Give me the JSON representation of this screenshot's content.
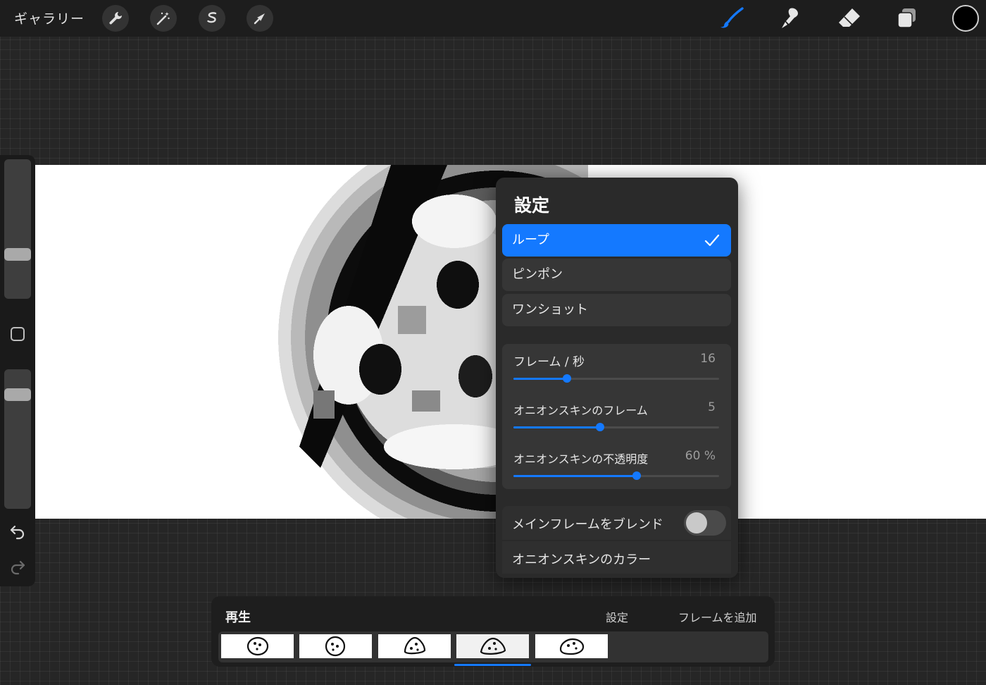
{
  "topbar": {
    "gallery_label": "ギャラリー",
    "left_tools": [
      "wrench-icon",
      "magic-wand-icon",
      "selection-icon",
      "transform-arrow-icon"
    ],
    "right_tools": [
      "brush-icon",
      "smudge-icon",
      "eraser-icon",
      "layers-icon"
    ],
    "active_tool": "brush-icon",
    "current_color": "#000000"
  },
  "sidebar": {
    "brush_size_level": 0.3,
    "opacity_level": 0.85,
    "icons": [
      "modify-square-icon",
      "undo-icon",
      "redo-icon"
    ]
  },
  "popover": {
    "title": "設定",
    "modes": [
      {
        "label": "ループ",
        "selected": true
      },
      {
        "label": "ピンポン",
        "selected": false
      },
      {
        "label": "ワンショット",
        "selected": false
      }
    ],
    "sliders": [
      {
        "label": "フレーム / 秒",
        "value": "16",
        "level": 0.26
      },
      {
        "label": "オニオンスキンのフレーム",
        "value": "5",
        "level": 0.42
      },
      {
        "label": "オニオンスキンの不透明度",
        "value": "60 %",
        "level": 0.6
      }
    ],
    "blend_label": "メインフレームをブレンド",
    "blend_on": false,
    "onion_color_label": "オニオンスキンのカラー"
  },
  "timeline": {
    "play_label": "再生",
    "settings_label": "設定",
    "add_frame_label": "フレームを追加",
    "frame_count": 5,
    "current_frame": 4
  },
  "colors": {
    "accent": "#1479ff",
    "panel": "#2a2a2a",
    "canvas": "#ffffff"
  }
}
